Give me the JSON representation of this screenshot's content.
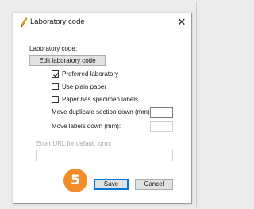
{
  "window": {
    "title": "Laboratory code",
    "close_glyph": "✕",
    "title_icon": "pen-icon"
  },
  "form": {
    "lab_code_label": "Laboratory code:",
    "edit_button_label": "Edit laboratory code",
    "checkboxes": [
      {
        "label": "Preferred laboratory",
        "checked": true
      },
      {
        "label": "Use plain paper",
        "checked": false
      },
      {
        "label": "Paper has specimen labels",
        "checked": false
      }
    ],
    "move_duplicate_label": "Move duplicate section down (mm):",
    "move_duplicate_value": "",
    "move_labels_label": "Move labels down (mm):",
    "move_labels_value": "",
    "url_label": "Enter URL for default form:",
    "url_value": ""
  },
  "buttons": {
    "save_label": "Save",
    "cancel_label": "Cancel"
  },
  "annotation": {
    "step_number": "5",
    "color": "#f28c28"
  }
}
